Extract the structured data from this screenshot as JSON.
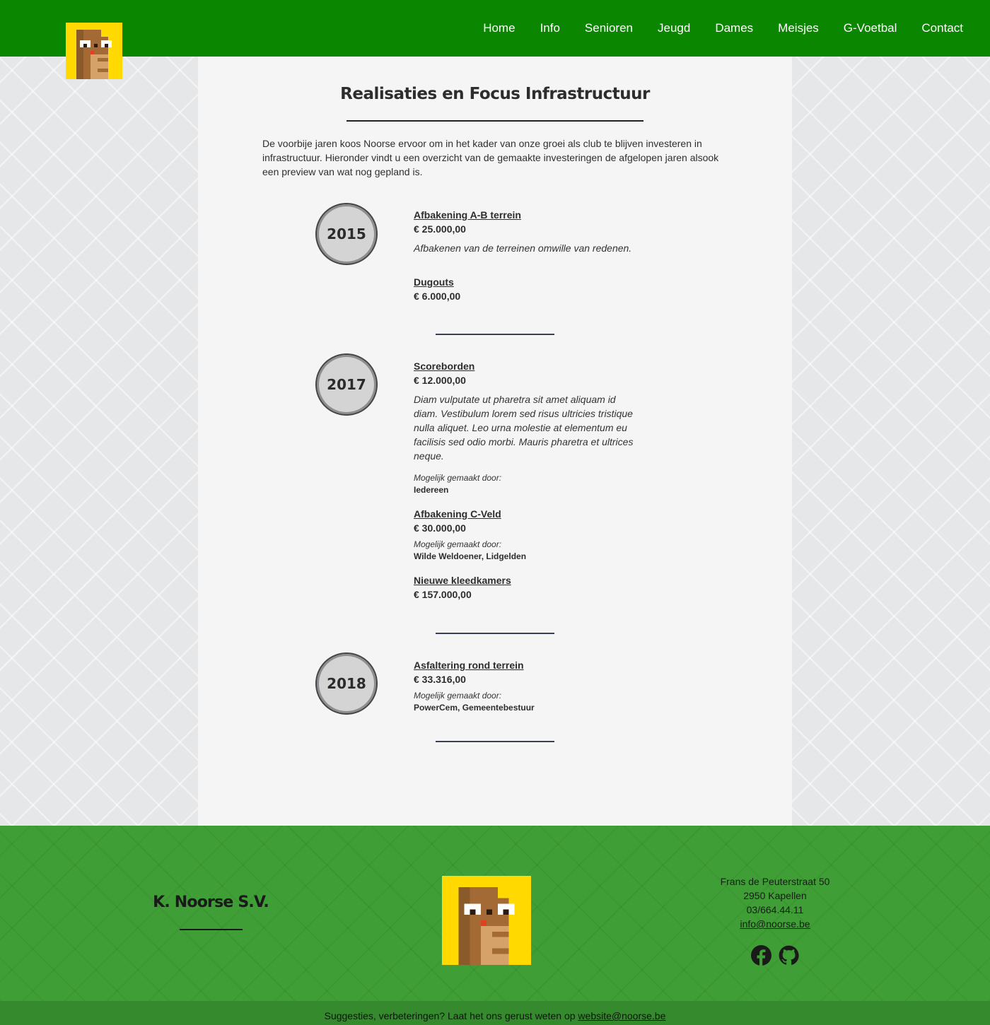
{
  "nav": {
    "items": [
      "Home",
      "Info",
      "Senioren",
      "Jeugd",
      "Dames",
      "Meisjes",
      "G-Voetbal",
      "Contact"
    ]
  },
  "main": {
    "title": "Realisaties en Focus Infrastructuur",
    "intro": "De voorbije jaren koos Noorse ervoor om in het kader van onze groei als club te blijven investeren in infrastructuur. Hieronder vindt u een overzicht van de gemaakte investeringen de afgelopen jaren alsook een preview van wat nog gepland is.",
    "years": [
      {
        "year": "2015",
        "items": [
          {
            "title": "Afbakening A-B terrein",
            "cost": "€ 25.000,00",
            "desc": "Afbakenen van de terreinen omwille van redenen."
          },
          {
            "title": "Dugouts",
            "cost": "€ 6.000,00"
          }
        ]
      },
      {
        "year": "2017",
        "items": [
          {
            "title": "Scoreborden",
            "cost": "€ 12.000,00",
            "desc": "Diam vulputate ut pharetra sit amet aliquam id diam. Vestibulum lorem sed risus ultricies tristique nulla aliquet. Leo urna molestie at elementum eu facilisis sed odio morbi. Mauris pharetra et ultrices neque.",
            "by_label": "Mogelijk gemaakt door:",
            "by": "Iedereen"
          },
          {
            "title": "Afbakening C-Veld",
            "cost": "€ 30.000,00",
            "by_label": "Mogelijk gemaakt door:",
            "by": "Wilde Weldoener, Lidgelden"
          },
          {
            "title": "Nieuwe kleedkamers",
            "cost": "€ 157.000,00"
          }
        ]
      },
      {
        "year": "2018",
        "items": [
          {
            "title": "Asfaltering rond terrein",
            "cost": "€ 33.316,00",
            "by_label": "Mogelijk gemaakt door:",
            "by": "PowerCem, Gemeentebestuur"
          }
        ]
      }
    ]
  },
  "footer": {
    "club_name": "K. Noorse S.V.",
    "address_line1": "Frans de Peuterstraat 50",
    "address_line2": "2950 Kapellen",
    "phone": "03/664.44.11",
    "email": "info@noorse.be",
    "social_icons": [
      "facebook-icon",
      "github-icon"
    ],
    "bottom_text": "Suggesties, verbeteringen? Laat het ons gerust weten op",
    "bottom_email": "website@noorse.be"
  },
  "colors": {
    "nav_bg": "#0a8600",
    "footer_bg": "#3f9f36",
    "bottom_bar_bg": "#358a2e",
    "panel_bg": "#f5f5f5",
    "logo_bg": "#ffd900"
  }
}
